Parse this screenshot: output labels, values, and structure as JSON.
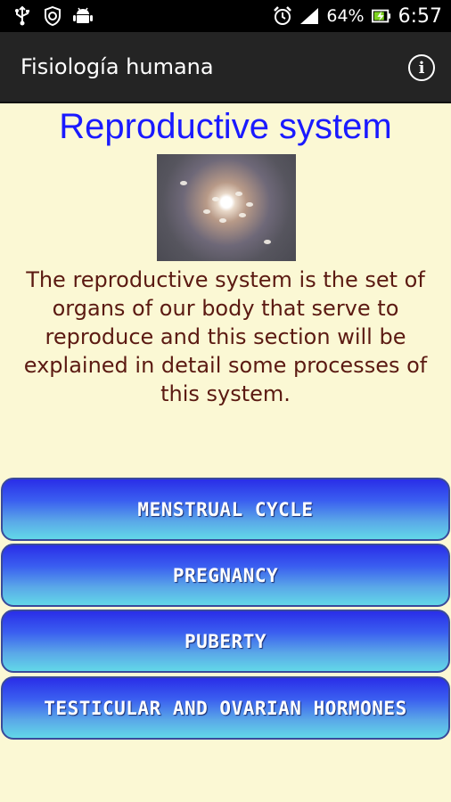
{
  "status_bar": {
    "battery_percent": "64%",
    "time": "6:57",
    "icons": [
      "usb-icon",
      "vpn-shield-icon",
      "android-icon",
      "alarm-clock-icon",
      "signal-icon",
      "battery-charging-icon"
    ]
  },
  "action_bar": {
    "title": "Fisiología humana",
    "info_icon": "info-icon",
    "info_glyph": "i"
  },
  "main": {
    "title": "Reproductive system",
    "description": "The reproductive system is the set of organs of our body that serve to reproduce and this section will be explained in detail some processes of this system.",
    "buttons": [
      {
        "label": "MENSTRUAL CYCLE"
      },
      {
        "label": "PREGNANCY"
      },
      {
        "label": "PUBERTY"
      },
      {
        "label": "TESTICULAR AND OVARIAN HORMONES"
      }
    ]
  },
  "colors": {
    "background": "#fbf8d4",
    "title": "#1a1aff",
    "description": "#5b1a12",
    "action_bar": "#242424"
  }
}
